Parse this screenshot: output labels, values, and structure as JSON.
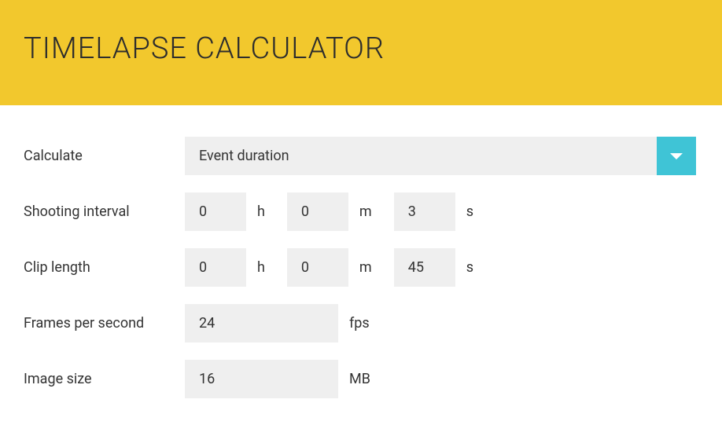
{
  "header": {
    "title": "TIMELAPSE CALCULATOR"
  },
  "form": {
    "calculate": {
      "label": "Calculate",
      "value": "Event duration"
    },
    "shootingInterval": {
      "label": "Shooting interval",
      "hours": "0",
      "hoursUnit": "h",
      "minutes": "0",
      "minutesUnit": "m",
      "seconds": "3",
      "secondsUnit": "s"
    },
    "clipLength": {
      "label": "Clip length",
      "hours": "0",
      "hoursUnit": "h",
      "minutes": "0",
      "minutesUnit": "m",
      "seconds": "45",
      "secondsUnit": "s"
    },
    "fps": {
      "label": "Frames per second",
      "value": "24",
      "unit": "fps"
    },
    "imageSize": {
      "label": "Image size",
      "value": "16",
      "unit": "MB"
    }
  }
}
